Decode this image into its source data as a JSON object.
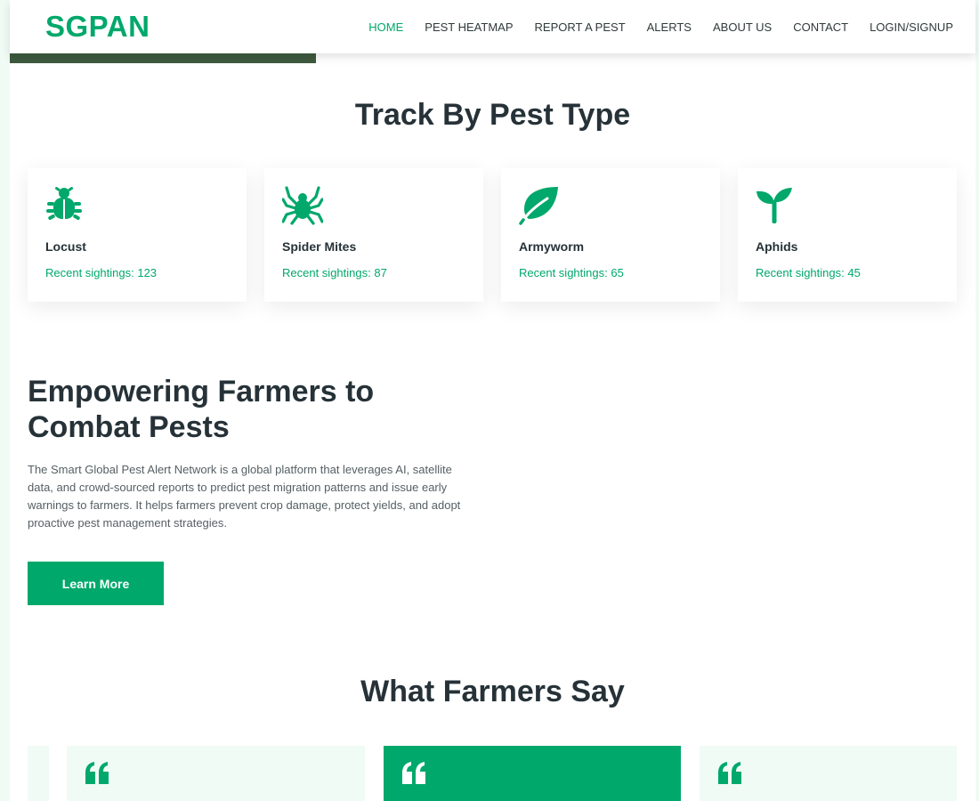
{
  "brand": {
    "logo": "SGPAN",
    "accent": "#00a86b",
    "text_dark": "#263238"
  },
  "nav": {
    "items": [
      {
        "label": "HOME",
        "active": true
      },
      {
        "label": "PEST HEATMAP"
      },
      {
        "label": "REPORT A PEST"
      },
      {
        "label": "ALERTS"
      },
      {
        "label": "ABOUT US"
      },
      {
        "label": "CONTACT"
      },
      {
        "label": "LOGIN/SIGNUP"
      }
    ]
  },
  "pest_section": {
    "title": "Track By Pest Type",
    "cards": [
      {
        "name": "Locust",
        "sightings": "Recent sightings: 123",
        "icon": "bug-icon"
      },
      {
        "name": "Spider Mites",
        "sightings": "Recent sightings: 87",
        "icon": "spider-icon"
      },
      {
        "name": "Armyworm",
        "sightings": "Recent sightings: 65",
        "icon": "leaf-icon"
      },
      {
        "name": "Aphids",
        "sightings": "Recent sightings: 45",
        "icon": "seedling-icon"
      }
    ]
  },
  "about": {
    "title": "Empowering Farmers to Combat Pests",
    "text": "The Smart Global Pest Alert Network is a global platform that leverages AI, satellite data, and crowd-sourced reports to predict pest migration patterns and issue early warnings to farmers. It helps farmers prevent crop damage, protect yields, and adopt proactive pest management strategies.",
    "button": "Learn More"
  },
  "testimonials": {
    "title": "What Farmers Say",
    "quote_icon": "quote-icon"
  }
}
